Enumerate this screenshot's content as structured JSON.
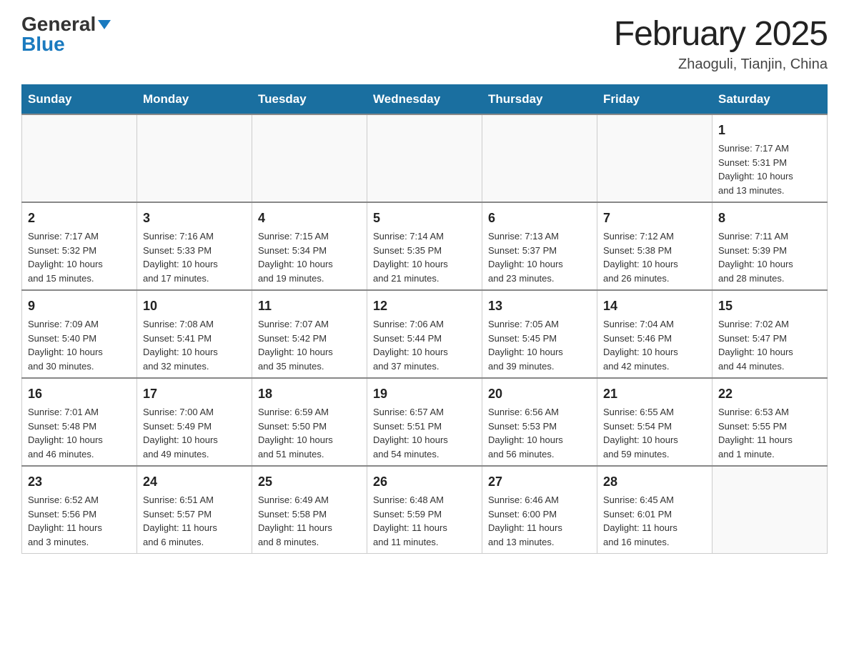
{
  "logo": {
    "general": "General",
    "blue": "Blue"
  },
  "title": "February 2025",
  "location": "Zhaoguli, Tianjin, China",
  "weekdays": [
    "Sunday",
    "Monday",
    "Tuesday",
    "Wednesday",
    "Thursday",
    "Friday",
    "Saturday"
  ],
  "weeks": [
    [
      {
        "day": "",
        "info": ""
      },
      {
        "day": "",
        "info": ""
      },
      {
        "day": "",
        "info": ""
      },
      {
        "day": "",
        "info": ""
      },
      {
        "day": "",
        "info": ""
      },
      {
        "day": "",
        "info": ""
      },
      {
        "day": "1",
        "info": "Sunrise: 7:17 AM\nSunset: 5:31 PM\nDaylight: 10 hours\nand 13 minutes."
      }
    ],
    [
      {
        "day": "2",
        "info": "Sunrise: 7:17 AM\nSunset: 5:32 PM\nDaylight: 10 hours\nand 15 minutes."
      },
      {
        "day": "3",
        "info": "Sunrise: 7:16 AM\nSunset: 5:33 PM\nDaylight: 10 hours\nand 17 minutes."
      },
      {
        "day": "4",
        "info": "Sunrise: 7:15 AM\nSunset: 5:34 PM\nDaylight: 10 hours\nand 19 minutes."
      },
      {
        "day": "5",
        "info": "Sunrise: 7:14 AM\nSunset: 5:35 PM\nDaylight: 10 hours\nand 21 minutes."
      },
      {
        "day": "6",
        "info": "Sunrise: 7:13 AM\nSunset: 5:37 PM\nDaylight: 10 hours\nand 23 minutes."
      },
      {
        "day": "7",
        "info": "Sunrise: 7:12 AM\nSunset: 5:38 PM\nDaylight: 10 hours\nand 26 minutes."
      },
      {
        "day": "8",
        "info": "Sunrise: 7:11 AM\nSunset: 5:39 PM\nDaylight: 10 hours\nand 28 minutes."
      }
    ],
    [
      {
        "day": "9",
        "info": "Sunrise: 7:09 AM\nSunset: 5:40 PM\nDaylight: 10 hours\nand 30 minutes."
      },
      {
        "day": "10",
        "info": "Sunrise: 7:08 AM\nSunset: 5:41 PM\nDaylight: 10 hours\nand 32 minutes."
      },
      {
        "day": "11",
        "info": "Sunrise: 7:07 AM\nSunset: 5:42 PM\nDaylight: 10 hours\nand 35 minutes."
      },
      {
        "day": "12",
        "info": "Sunrise: 7:06 AM\nSunset: 5:44 PM\nDaylight: 10 hours\nand 37 minutes."
      },
      {
        "day": "13",
        "info": "Sunrise: 7:05 AM\nSunset: 5:45 PM\nDaylight: 10 hours\nand 39 minutes."
      },
      {
        "day": "14",
        "info": "Sunrise: 7:04 AM\nSunset: 5:46 PM\nDaylight: 10 hours\nand 42 minutes."
      },
      {
        "day": "15",
        "info": "Sunrise: 7:02 AM\nSunset: 5:47 PM\nDaylight: 10 hours\nand 44 minutes."
      }
    ],
    [
      {
        "day": "16",
        "info": "Sunrise: 7:01 AM\nSunset: 5:48 PM\nDaylight: 10 hours\nand 46 minutes."
      },
      {
        "day": "17",
        "info": "Sunrise: 7:00 AM\nSunset: 5:49 PM\nDaylight: 10 hours\nand 49 minutes."
      },
      {
        "day": "18",
        "info": "Sunrise: 6:59 AM\nSunset: 5:50 PM\nDaylight: 10 hours\nand 51 minutes."
      },
      {
        "day": "19",
        "info": "Sunrise: 6:57 AM\nSunset: 5:51 PM\nDaylight: 10 hours\nand 54 minutes."
      },
      {
        "day": "20",
        "info": "Sunrise: 6:56 AM\nSunset: 5:53 PM\nDaylight: 10 hours\nand 56 minutes."
      },
      {
        "day": "21",
        "info": "Sunrise: 6:55 AM\nSunset: 5:54 PM\nDaylight: 10 hours\nand 59 minutes."
      },
      {
        "day": "22",
        "info": "Sunrise: 6:53 AM\nSunset: 5:55 PM\nDaylight: 11 hours\nand 1 minute."
      }
    ],
    [
      {
        "day": "23",
        "info": "Sunrise: 6:52 AM\nSunset: 5:56 PM\nDaylight: 11 hours\nand 3 minutes."
      },
      {
        "day": "24",
        "info": "Sunrise: 6:51 AM\nSunset: 5:57 PM\nDaylight: 11 hours\nand 6 minutes."
      },
      {
        "day": "25",
        "info": "Sunrise: 6:49 AM\nSunset: 5:58 PM\nDaylight: 11 hours\nand 8 minutes."
      },
      {
        "day": "26",
        "info": "Sunrise: 6:48 AM\nSunset: 5:59 PM\nDaylight: 11 hours\nand 11 minutes."
      },
      {
        "day": "27",
        "info": "Sunrise: 6:46 AM\nSunset: 6:00 PM\nDaylight: 11 hours\nand 13 minutes."
      },
      {
        "day": "28",
        "info": "Sunrise: 6:45 AM\nSunset: 6:01 PM\nDaylight: 11 hours\nand 16 minutes."
      },
      {
        "day": "",
        "info": ""
      }
    ]
  ]
}
